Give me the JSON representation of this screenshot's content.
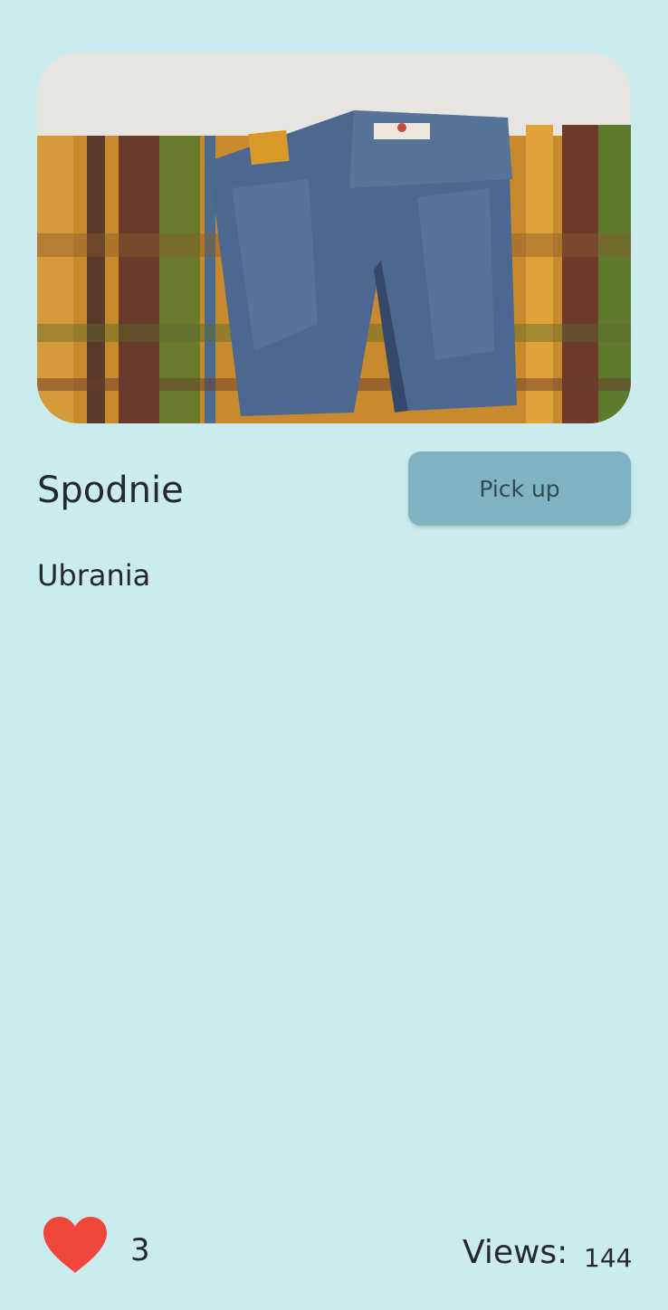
{
  "item": {
    "title": "Spodnie",
    "category": "Ubrania",
    "photo_subject": "jeans-on-plaid-blanket"
  },
  "actions": {
    "pickup_label": "Pick up"
  },
  "stats": {
    "likes": "3",
    "views_label": "Views:",
    "views_count": "144"
  },
  "colors": {
    "background": "#cbecee",
    "button": "#7fb3c2",
    "heart": "#f0463b"
  },
  "icons": {
    "like": "heart-icon"
  }
}
